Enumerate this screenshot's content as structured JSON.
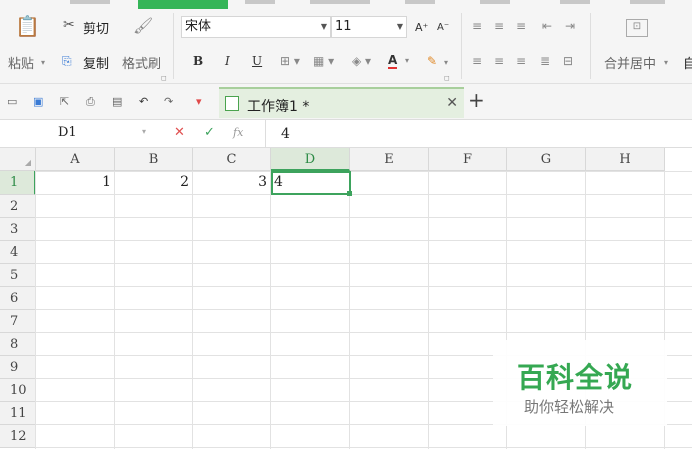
{
  "ribbon": {
    "paste_label": "粘贴",
    "cut_label": "剪切",
    "copy_label": "复制",
    "format_painter_label": "格式刷",
    "font_name": "宋体",
    "font_size": "11",
    "bold": "B",
    "italic": "I",
    "underline": "U",
    "merge_center_label": "合并居中",
    "truncated_label": "自"
  },
  "doc_tab": {
    "title": "工作簿1 *"
  },
  "formula_bar": {
    "name_box": "D1",
    "fx_label": "fx",
    "value": "4"
  },
  "grid": {
    "columns": [
      "A",
      "B",
      "C",
      "D",
      "E",
      "F",
      "G",
      "H"
    ],
    "rows": [
      "1",
      "2",
      "3",
      "4",
      "5",
      "6",
      "7",
      "8",
      "9",
      "10",
      "11",
      "12"
    ],
    "cells": {
      "A1": "1",
      "B1": "2",
      "C1": "3",
      "D1": "4"
    },
    "selected_cell": "D1"
  },
  "watermark": {
    "title": "百科全说",
    "subtitle": "助你轻松解决"
  },
  "colors": {
    "accent": "#3da35d",
    "watermark_green": "#35a852"
  }
}
